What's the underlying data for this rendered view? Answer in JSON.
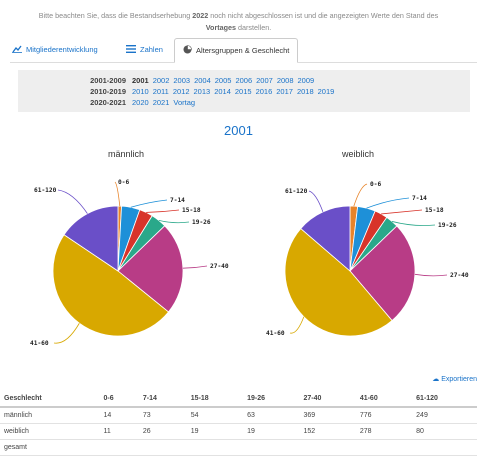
{
  "notice": {
    "line1": "Bitte beachten Sie, dass die Bestandserhebung",
    "year": "2022",
    "line1b": "noch nicht abgeschlossen ist und die angezeigten Werte den Stand des",
    "bold2": "Vortages",
    "line2b": "darstellen."
  },
  "tabs": [
    {
      "label": "Mitgliederentwicklung",
      "icon": "line-chart-icon"
    },
    {
      "label": "Zahlen",
      "icon": "list-icon"
    },
    {
      "label": "Altersgruppen & Geschlecht",
      "icon": "pie-chart-icon"
    }
  ],
  "years": [
    {
      "label": "2001-2009",
      "items": [
        "2001",
        "2002",
        "2003",
        "2004",
        "2005",
        "2006",
        "2007",
        "2008",
        "2009"
      ]
    },
    {
      "label": "2010-2019",
      "items": [
        "2010",
        "2011",
        "2012",
        "2013",
        "2014",
        "2015",
        "2016",
        "2017",
        "2018",
        "2019"
      ]
    },
    {
      "label": "2020-2021",
      "items": [
        "2020",
        "2021",
        "Vortag"
      ]
    }
  ],
  "selected_year": "2001",
  "export_label": "Exportieren",
  "chart_data": [
    {
      "type": "pie",
      "title": "männlich",
      "categories": [
        "0-6",
        "7-14",
        "15-18",
        "19-26",
        "27-40",
        "41-60",
        "61-120"
      ],
      "values": [
        14,
        73,
        54,
        63,
        369,
        776,
        249
      ],
      "colors": [
        "#e8842a",
        "#1e90d8",
        "#d8342a",
        "#2aa88a",
        "#b83c86",
        "#d8a800",
        "#6a4fc8"
      ]
    },
    {
      "type": "pie",
      "title": "weiblich",
      "categories": [
        "0-6",
        "7-14",
        "15-18",
        "19-26",
        "27-40",
        "41-60",
        "61-120"
      ],
      "values": [
        11,
        26,
        19,
        19,
        152,
        278,
        80
      ],
      "colors": [
        "#e8842a",
        "#1e90d8",
        "#d8342a",
        "#2aa88a",
        "#b83c86",
        "#d8a800",
        "#6a4fc8"
      ]
    }
  ],
  "table": {
    "headers": [
      "Geschlecht",
      "0-6",
      "7-14",
      "15-18",
      "19-26",
      "27-40",
      "41-60",
      "61-120"
    ],
    "rows": [
      [
        "männlich",
        "14",
        "73",
        "54",
        "63",
        "369",
        "776",
        "249"
      ],
      [
        "weiblich",
        "11",
        "26",
        "19",
        "19",
        "152",
        "278",
        "80"
      ],
      [
        "gesamt",
        "",
        "",
        "",
        "",
        "",
        "",
        ""
      ]
    ]
  }
}
